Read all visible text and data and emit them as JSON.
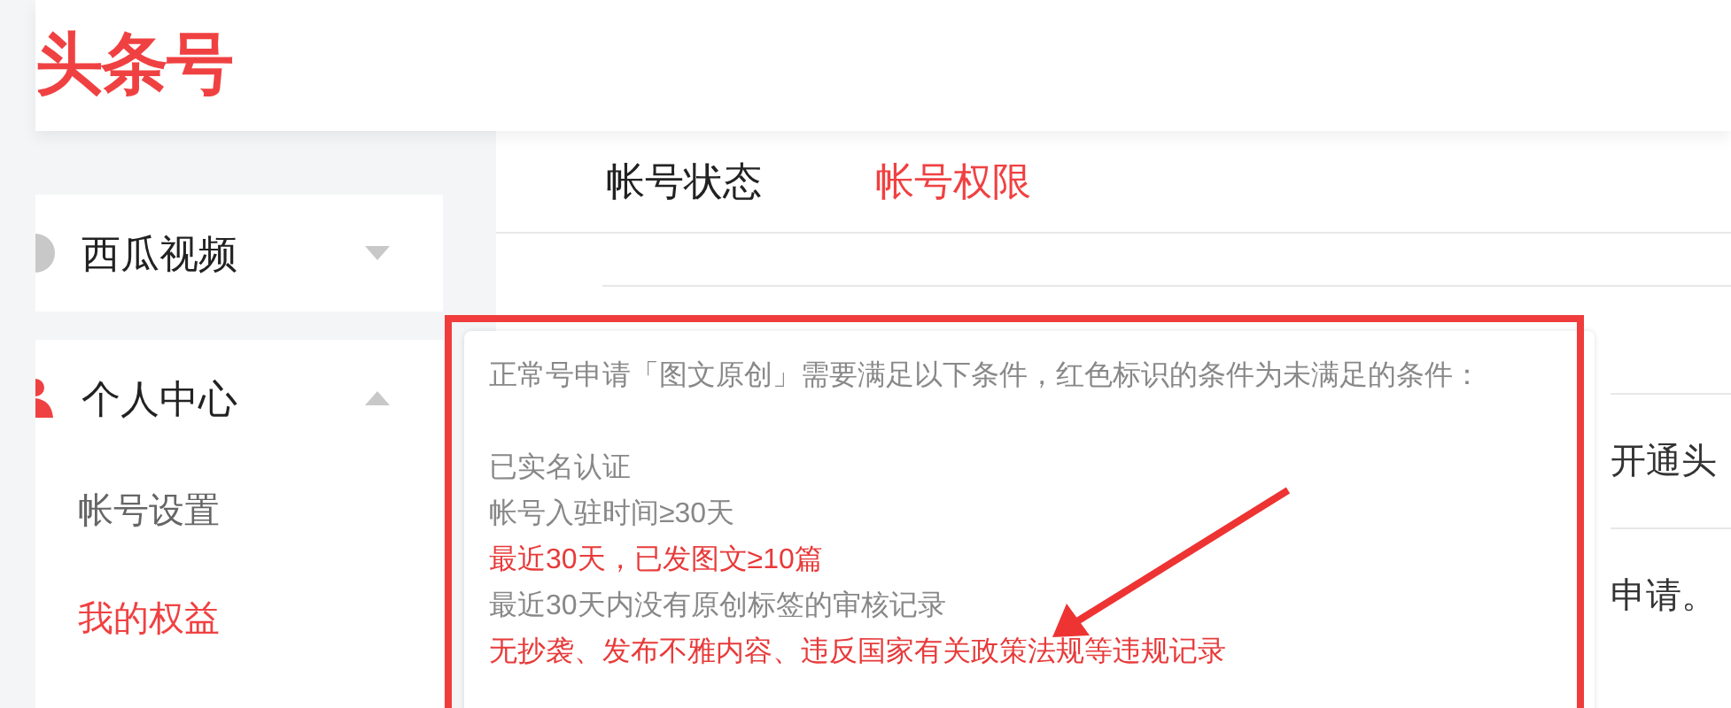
{
  "header": {
    "logo": "头条号"
  },
  "sidebar": {
    "items": [
      {
        "label": "西瓜视频",
        "expanded": false
      },
      {
        "label": "个人中心",
        "expanded": true,
        "children": [
          {
            "label": "帐号设置",
            "selected": false
          },
          {
            "label": "我的权益",
            "selected": true
          }
        ]
      }
    ]
  },
  "tabs": [
    {
      "label": "帐号状态",
      "selected": false
    },
    {
      "label": "帐号权限",
      "selected": true
    }
  ],
  "background_rows": [
    {
      "text": "开通头"
    },
    {
      "text": "申请。"
    }
  ],
  "popover": {
    "intro": "正常号申请「图文原创」需要满足以下条件，红色标识的条件为未满足的条件：",
    "conditions": [
      {
        "text": "已实名认证",
        "met": true
      },
      {
        "text": "帐号入驻时间≥30天",
        "met": true
      },
      {
        "text": "最近30天，已发图文≥10篇",
        "met": false
      },
      {
        "text": "最近30天内没有原创标签的审核记录",
        "met": true
      },
      {
        "text": "无抄袭、发布不雅内容、违反国家有关政策法规等违规记录",
        "met": false
      }
    ]
  }
}
